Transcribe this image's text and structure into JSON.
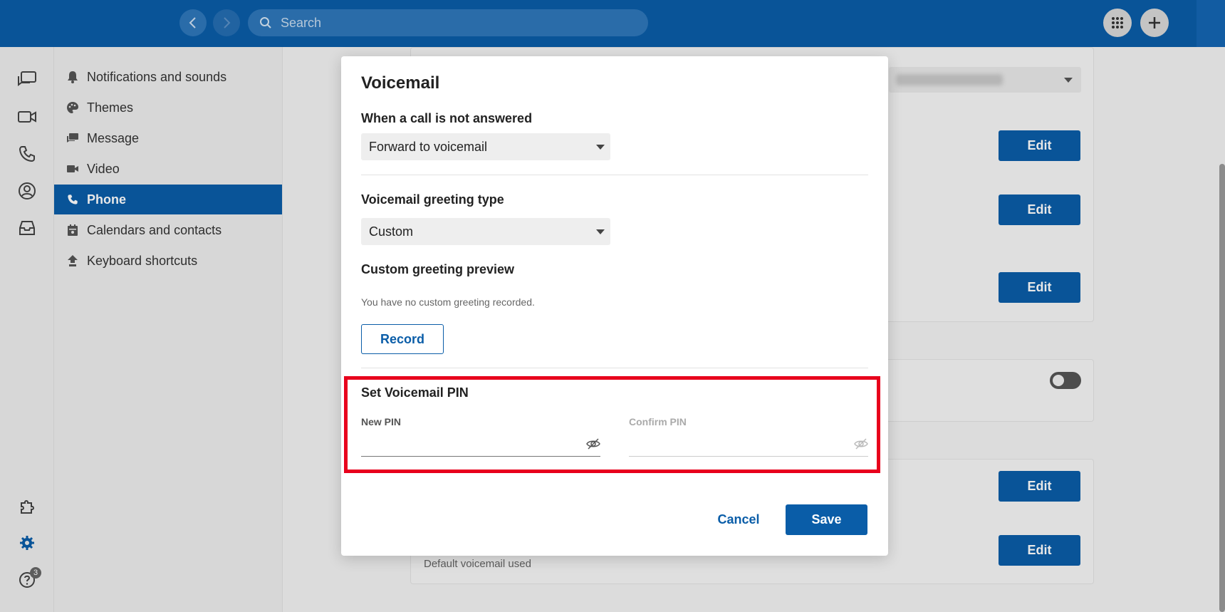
{
  "topbar": {
    "search_placeholder": "Search",
    "icons": [
      "back-arrow-icon",
      "forward-arrow-icon",
      "search-icon",
      "dialpad-icon",
      "plus-icon"
    ]
  },
  "rail": {
    "icons": [
      "chat-icon",
      "video-icon",
      "phone-icon",
      "contacts-icon",
      "inbox-icon",
      "apps-puzzle-icon",
      "settings-gear-icon",
      "help-icon"
    ],
    "help_badge": "3"
  },
  "settings_nav": {
    "items": [
      {
        "label": "Notifications and sounds",
        "icon": "bell-icon"
      },
      {
        "label": "Themes",
        "icon": "palette-icon"
      },
      {
        "label": "Message",
        "icon": "message-icon"
      },
      {
        "label": "Video",
        "icon": "video-icon"
      },
      {
        "label": "Phone",
        "icon": "phone-icon"
      },
      {
        "label": "Calendars and contacts",
        "icon": "calendar-icon"
      },
      {
        "label": "Keyboard shortcuts",
        "icon": "keyboard-icon"
      }
    ],
    "active_index": 4
  },
  "background": {
    "edit_label": "Edit",
    "footer_note": "Default voicemail used"
  },
  "modal": {
    "title": "Voicemail",
    "unanswered_label": "When a call is not answered",
    "unanswered_value": "Forward to voicemail",
    "greeting_type_label": "Voicemail greeting type",
    "greeting_type_value": "Custom",
    "preview_label": "Custom greeting preview",
    "preview_note": "You have no custom greeting recorded.",
    "record_label": "Record",
    "pin_section_title": "Set Voicemail PIN",
    "new_pin_label": "New PIN",
    "confirm_pin_label": "Confirm PIN",
    "cancel_label": "Cancel",
    "save_label": "Save"
  },
  "colors": {
    "brand": "#0a5da8",
    "highlight": "#e8001c"
  }
}
